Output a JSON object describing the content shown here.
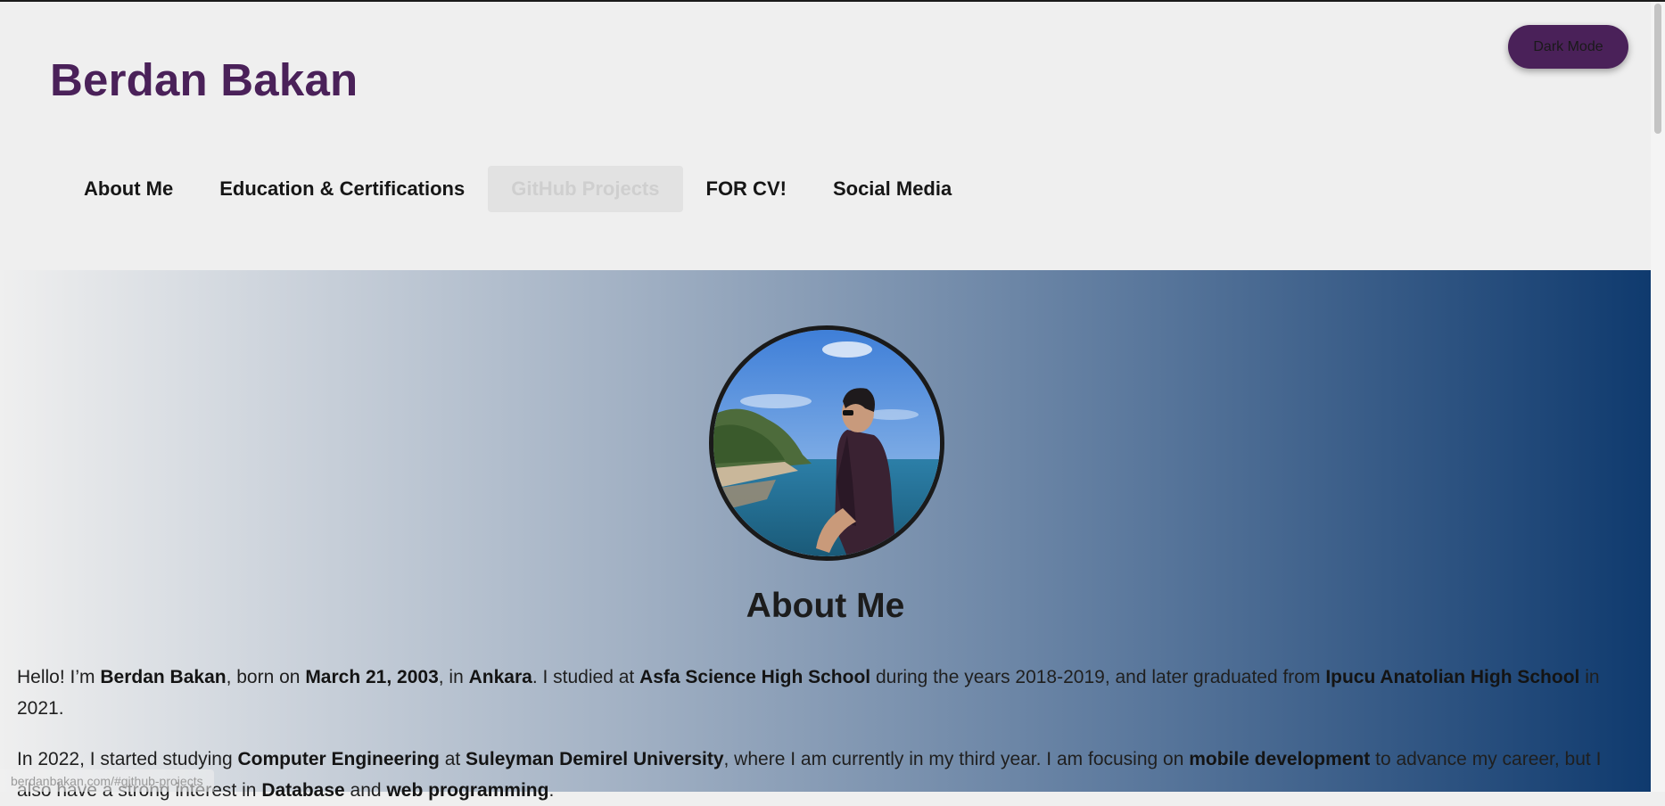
{
  "header": {
    "title": "Berdan Bakan",
    "dark_mode_label": "Dark Mode"
  },
  "nav": {
    "items": [
      {
        "label": "About Me",
        "active": false
      },
      {
        "label": "Education & Certifications",
        "active": false
      },
      {
        "label": "GitHub Projects",
        "active": true
      },
      {
        "label": "FOR CV!",
        "active": false
      },
      {
        "label": "Social Media",
        "active": false
      }
    ]
  },
  "about": {
    "title": "About Me",
    "paragraph1": {
      "t1": "Hello! I’m ",
      "name": "Berdan Bakan",
      "t2": ", born on ",
      "birthdate": "March 21, 2003",
      "t3": ", in ",
      "city": "Ankara",
      "t4": ". I studied at ",
      "school1": "Asfa Science High School",
      "t5": " during the years 2018-2019, and later graduated from ",
      "school2": "Ipucu Anatolian High School",
      "t6": " in 2021."
    },
    "paragraph2": {
      "t1": "In 2022, I started studying ",
      "major": "Computer Engineering",
      "t2": " at ",
      "university": "Suleyman Demirel University",
      "t3": ", where I am currently in my third year. I am focusing on ",
      "focus": "mobile development",
      "t4": " to advance my career, but I also have a strong interest in ",
      "interest1": "Database",
      "t5": " and ",
      "interest2": "web programming",
      "t6": "."
    }
  },
  "status_bar": {
    "url": "berdanbakan.com/#github-projects"
  },
  "colors": {
    "brand": "#4a2159",
    "gradient_start": "#efefef",
    "gradient_end": "#0f3a6e"
  },
  "icons": {
    "avatar": "profile-photo"
  }
}
